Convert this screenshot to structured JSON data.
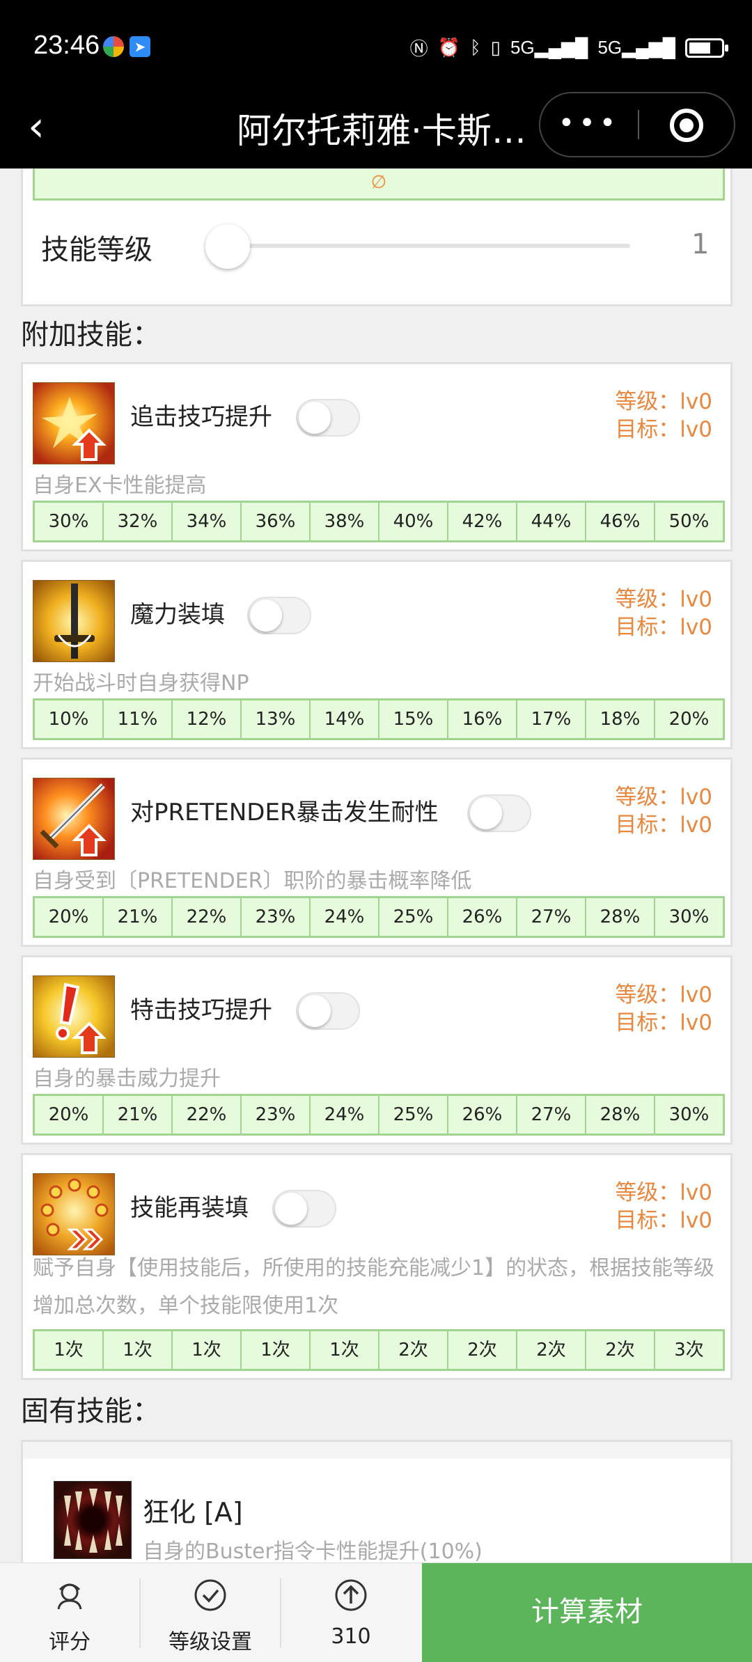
{
  "status_bar": {
    "time": "23:46",
    "network": "5G",
    "network2": "5G"
  },
  "nav": {
    "back_symbol": "‹",
    "title": "阿尔托莉雅·卡斯…",
    "more_symbol": "•••"
  },
  "top_card": {
    "null_value": "∅",
    "level_label": "技能等级",
    "level_value": "1"
  },
  "append_section_title": "附加技能：",
  "append_skills": [
    {
      "name": "追击技巧提升",
      "level_label": "等级：lv0",
      "target_label": "目标：lv0",
      "desc": "自身EX卡性能提高",
      "values": [
        "30%",
        "32%",
        "34%",
        "36%",
        "38%",
        "40%",
        "42%",
        "44%",
        "46%",
        "50%"
      ],
      "enabled": false
    },
    {
      "name": "魔力装填",
      "level_label": "等级：lv0",
      "target_label": "目标：lv0",
      "desc": "开始战斗时自身获得NP",
      "values": [
        "10%",
        "11%",
        "12%",
        "13%",
        "14%",
        "15%",
        "16%",
        "17%",
        "18%",
        "20%"
      ],
      "enabled": false
    },
    {
      "name": "对PRETENDER暴击发生耐性",
      "level_label": "等级：lv0",
      "target_label": "目标：lv0",
      "desc": "自身受到〔PRETENDER〕职阶的暴击概率降低",
      "values": [
        "20%",
        "21%",
        "22%",
        "23%",
        "24%",
        "25%",
        "26%",
        "27%",
        "28%",
        "30%"
      ],
      "enabled": false
    },
    {
      "name": "特击技巧提升",
      "level_label": "等级：lv0",
      "target_label": "目标：lv0",
      "desc": "自身的暴击威力提升",
      "values": [
        "20%",
        "21%",
        "22%",
        "23%",
        "24%",
        "25%",
        "26%",
        "27%",
        "28%",
        "30%"
      ],
      "enabled": false
    },
    {
      "name": "技能再装填",
      "level_label": "等级：lv0",
      "target_label": "目标：lv0",
      "desc": "赋予自身【使用技能后，所使用的技能充能减少1】的状态，根据技能等级增加总次数，单个技能限使用1次",
      "values": [
        "1次",
        "1次",
        "1次",
        "1次",
        "1次",
        "2次",
        "2次",
        "2次",
        "2次",
        "3次"
      ],
      "enabled": false
    }
  ],
  "inherent_section_title": "固有技能：",
  "inherent_skill": {
    "name": "狂化 [A]",
    "desc": "自身的Buster指令卡性能提升(10%)"
  },
  "bottom_bar": {
    "rating_label": "评分",
    "level_settings_label": "等级设置",
    "count_label": "310",
    "calc_label": "计算素材"
  },
  "colors": {
    "accent_green": "#5cb55a",
    "cell_bg": "#e6fbdc",
    "cell_border": "#9fd58c",
    "level_orange": "#e8873e"
  }
}
